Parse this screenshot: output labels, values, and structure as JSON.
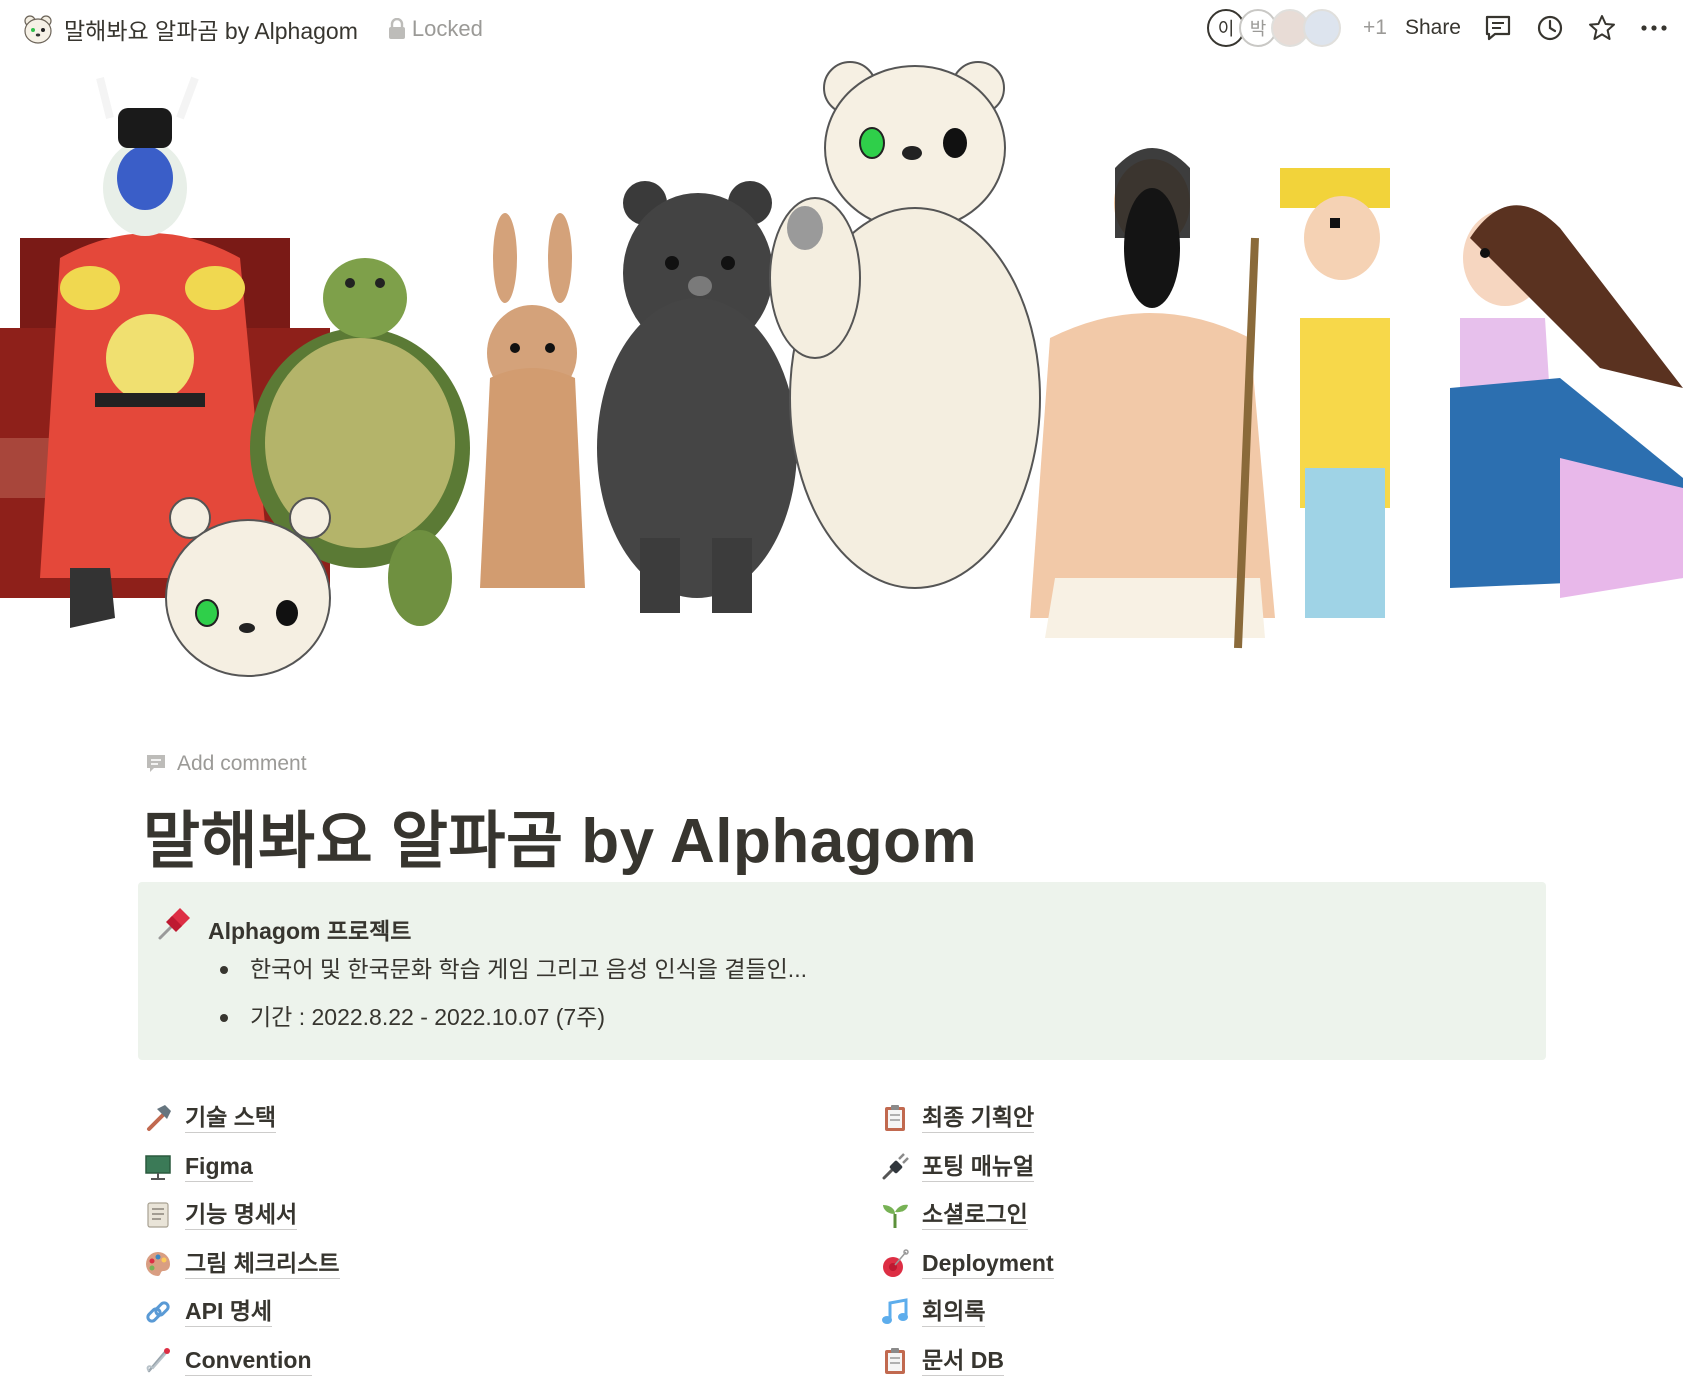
{
  "topbar": {
    "title": "말해봐요 알파곰 by Alphagom",
    "lock_label": "Locked",
    "avatars": [
      "이",
      "박"
    ],
    "more_users": "+1",
    "share_label": "Share"
  },
  "page": {
    "add_comment": "Add comment",
    "title": "말해봐요 알파곰 by Alphagom"
  },
  "callout": {
    "icon": "pushpin-icon",
    "title": "Alphagom 프로젝트",
    "bullets": [
      "한국어 및 한국문화 학습 게임 그리고 음성 인식을 곁들인...",
      "기간 : 2022.8.22 - 2022.10.07 (7주)"
    ]
  },
  "links_left": [
    {
      "icon": "hammer-icon",
      "label": "기술 스택"
    },
    {
      "icon": "presentation-board-icon",
      "label": "Figma"
    },
    {
      "icon": "scroll-icon",
      "label": "기능 명세서"
    },
    {
      "icon": "palette-icon",
      "label": "그림 체크리스트"
    },
    {
      "icon": "chain-link-icon",
      "label": "API 명세"
    },
    {
      "icon": "safety-pin-icon",
      "label": "Convention"
    }
  ],
  "links_right": [
    {
      "icon": "clipboard-icon",
      "label": "최종 기획안"
    },
    {
      "icon": "plug-icon",
      "label": "포팅 매뉴얼"
    },
    {
      "icon": "seedling-icon",
      "label": "소셜로그인"
    },
    {
      "icon": "yoyo-icon",
      "label": "Deployment"
    },
    {
      "icon": "music-notes-icon",
      "label": "회의록"
    },
    {
      "icon": "clipboard-icon",
      "label": "문서 DB"
    }
  ],
  "colors": {
    "text": "#37352f",
    "muted": "#9b9a97",
    "callout_bg": "#edf3ec"
  }
}
